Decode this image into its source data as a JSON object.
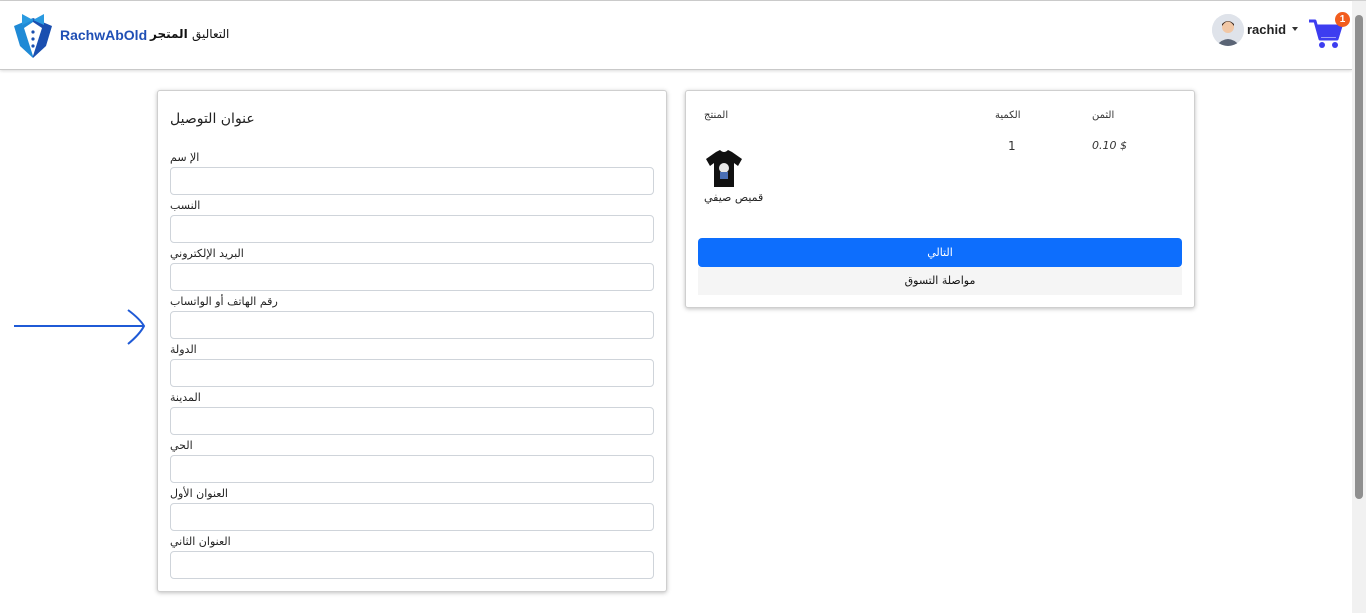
{
  "navbar": {
    "brand": "RachwAbOld",
    "links": {
      "store": "المتجر",
      "comments": "التعاليق"
    },
    "user": {
      "name": "rachid"
    },
    "cart_count": "1"
  },
  "form": {
    "title": "عنوان التوصيل",
    "fields": [
      {
        "label": "الإ سم",
        "value": ""
      },
      {
        "label": "النسب",
        "value": ""
      },
      {
        "label": "البريد الإلكتروني",
        "value": ""
      },
      {
        "label": "رقم الهاتف أو الواتساب",
        "value": ""
      },
      {
        "label": "الدولة",
        "value": ""
      },
      {
        "label": "المدينة",
        "value": ""
      },
      {
        "label": "الحي",
        "value": ""
      },
      {
        "label": "العنوان الأول",
        "value": ""
      },
      {
        "label": "العنوان الثاني",
        "value": ""
      }
    ]
  },
  "cart": {
    "headers": {
      "product": "المنتج",
      "quantity": "الكمية",
      "price": "الثمن"
    },
    "items": [
      {
        "name": "قميص صيفي",
        "quantity": "1",
        "price": "0.10 $",
        "image": "black-tshirt-icon"
      }
    ],
    "next_label": "التالي",
    "continue_label": "مواصلة التسوق"
  },
  "colors": {
    "primary": "#0d6efd",
    "brand": "#1f4fb5",
    "badge": "#f25d1e",
    "cart_icon": "#3d3df0",
    "arrow": "#1f5ad6"
  }
}
